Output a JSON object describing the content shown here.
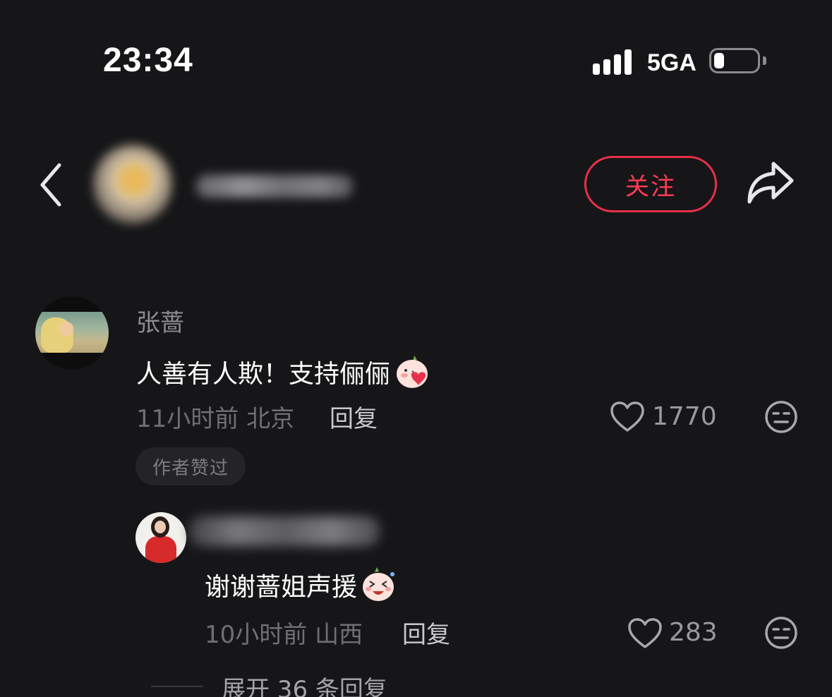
{
  "status_bar": {
    "time": "23:34",
    "network": "5GA",
    "signal_bars": 4,
    "battery_level": 0.2
  },
  "header": {
    "back_icon": "chevron-left-icon",
    "follow_label": "关注",
    "share_icon": "share-arrow-icon",
    "accent_color": "#ff3b55"
  },
  "comment": {
    "author": "张蔷",
    "text": "人善有人欺！支持俪俪",
    "emoji": "blushing-kiss-emoji",
    "time": "11小时前",
    "location": "北京",
    "reply_label": "回复",
    "likes": "1770",
    "author_liked_badge": "作者赞过"
  },
  "reply": {
    "text": "谢谢蔷姐声援",
    "emoji": "laughing-emoji",
    "time": "10小时前",
    "location": "山西",
    "reply_label": "回复",
    "likes": "283"
  },
  "expand_label": "展开 36 条回复"
}
